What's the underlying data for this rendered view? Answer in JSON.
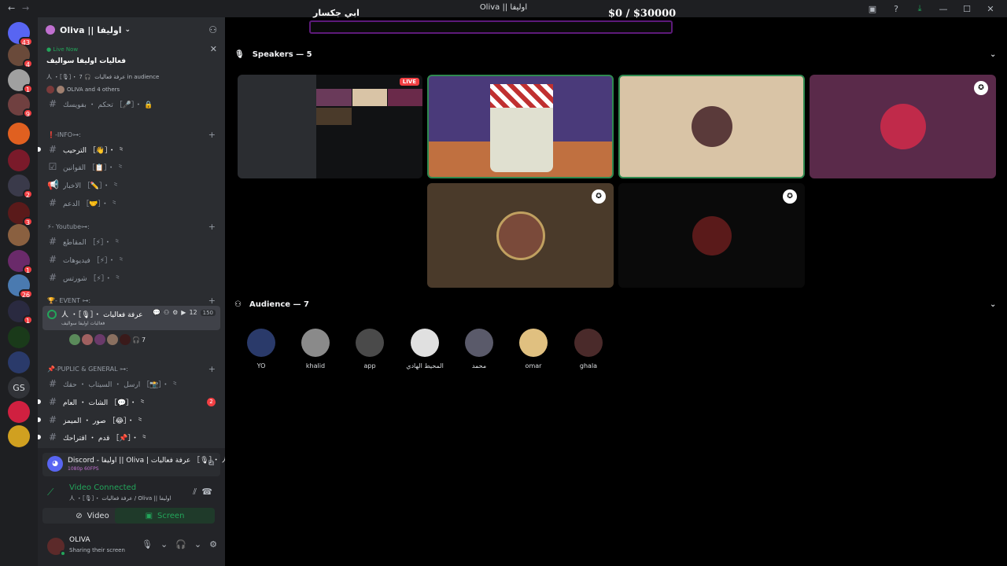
{
  "window": {
    "title": "Oliva || اوليفا",
    "controls": [
      "screen-share-icon",
      "help-icon",
      "download-icon",
      "minimize-icon",
      "maximize-icon",
      "close-icon"
    ]
  },
  "overlay": {
    "name": "ابي جكسار",
    "money": "$0   / $30000"
  },
  "server_rail": {
    "items": [
      {
        "label": "Direct Messages",
        "badge": "43",
        "color": "#5865f2"
      },
      {
        "label": "server",
        "badge": "4",
        "color": "#6a4a3a"
      },
      {
        "label": "server",
        "badge": "1",
        "color": "#a0a0a0"
      },
      {
        "label": "server",
        "badge": "9",
        "color": "#704040"
      },
      {
        "label": "server",
        "badge": "",
        "color": "#e06020"
      },
      {
        "label": "server",
        "badge": "",
        "color": "#7a1a2a"
      },
      {
        "label": "server",
        "badge": "2",
        "color": "#3a3a4a"
      },
      {
        "label": "server",
        "badge": "3",
        "color": "#5a1a1a"
      },
      {
        "label": "server",
        "badge": "",
        "color": "#8a6040"
      },
      {
        "label": "server",
        "badge": "1",
        "color": "#6a2a6a"
      },
      {
        "label": "server",
        "badge": "26",
        "color": "#4a7ab0"
      },
      {
        "label": "server",
        "badge": "1",
        "color": "#2a2a40"
      },
      {
        "label": "server",
        "badge": "",
        "color": "#1a3a1a"
      },
      {
        "label": "server",
        "badge": "",
        "color": "#2a3a6a"
      },
      {
        "label": "GS",
        "badge": "",
        "color": "#313338"
      },
      {
        "label": "server",
        "badge": "",
        "color": "#d02040"
      },
      {
        "label": "server",
        "badge": "",
        "color": "#d0a020"
      }
    ]
  },
  "guild": {
    "name": "Oliva || اوليفا"
  },
  "live_card": {
    "status": "Live Now",
    "title": "فعاليات اوليفا سواليف",
    "channel": "人 ・［🎙］・ عرفة فعاليات",
    "audience": "7 in audience",
    "people": "OLIVA and 4 others"
  },
  "channels": [
    {
      "type": "channel",
      "name": "تحكم ・ بفويسك ［🎤］・ 🔒",
      "unread": false
    },
    {
      "type": "category",
      "name": "❗-INFO⊶: "
    },
    {
      "type": "channel",
      "name": "الترحيب ［👋］・ ⺀ ",
      "unread": true
    },
    {
      "type": "channel",
      "name": "القوانين ［📋］・ ⺀ ",
      "unread": false
    },
    {
      "type": "channel",
      "name": "الاخبار ［✏️］・ ⺀ ",
      "unread": false
    },
    {
      "type": "channel",
      "name": "الدعم ［🤝］・ ⺀ ",
      "unread": false
    },
    {
      "type": "category",
      "name": "⚡- Youtube⊶: "
    },
    {
      "type": "channel",
      "name": "المقاطع ［⚡］・ ⺀ ",
      "unread": false
    },
    {
      "type": "channel",
      "name": "فيديوهات ［⚡］・ ⺀ ",
      "unread": false
    },
    {
      "type": "channel",
      "name": "شورتس ［⚡］・ ⺀ ",
      "unread": false
    },
    {
      "type": "category",
      "name": "🏆- EVENT ⊶: "
    },
    {
      "type": "category",
      "name": "📌-PUPLIC & GENERAL ⊶: "
    },
    {
      "type": "channel",
      "name": "ارسل ・ السيتاب ・ حقك ［📸］・ ⺀",
      "unread": false
    },
    {
      "type": "channel",
      "name": "الشات ・ العام ［💬］・ ⺀",
      "unread": true,
      "badge": "2"
    },
    {
      "type": "channel",
      "name": "صور ・ الميمز ［😂］・ ⺀",
      "unread": true
    },
    {
      "type": "channel",
      "name": "قدم ・ اقتراحك ［📌］・ ⺀",
      "unread": true
    }
  ],
  "stage_channel": {
    "name": "人 ・［🎙］・ عرفة فعاليات",
    "sub": "فعاليات اوليفا سواليف",
    "count": "12",
    "limit": "150",
    "audience_count": "7"
  },
  "voice_panel": {
    "app_title": "Discord - اوليفا || Oliva | عرفة فعاليات ［🎙］・ 人",
    "quality": "1080p 60FPS",
    "connection": "Video Connected",
    "connection_sub": "人 ・［🎙］・ عرفة فعاليات / Oliva || اوليفا",
    "video_label": "Video",
    "screen_label": "Screen",
    "username": "OLIVA",
    "user_status": "Sharing their screen"
  },
  "speakers": {
    "title": "Speakers — 5",
    "live": "LIVE"
  },
  "audience": {
    "title": "Audience — 7",
    "members": [
      {
        "name": "YO",
        "color": "#2a3a6a"
      },
      {
        "name": "khalid",
        "color": "#8a8a8a"
      },
      {
        "name": "app",
        "color": "#4a4a4a"
      },
      {
        "name": "المحيط الهادي",
        "color": "#e0e0e0"
      },
      {
        "name": "محمد",
        "color": "#5a5a6a"
      },
      {
        "name": "omar",
        "color": "#e0c080"
      },
      {
        "name": "ghala",
        "color": "#4a2a2a"
      }
    ]
  }
}
